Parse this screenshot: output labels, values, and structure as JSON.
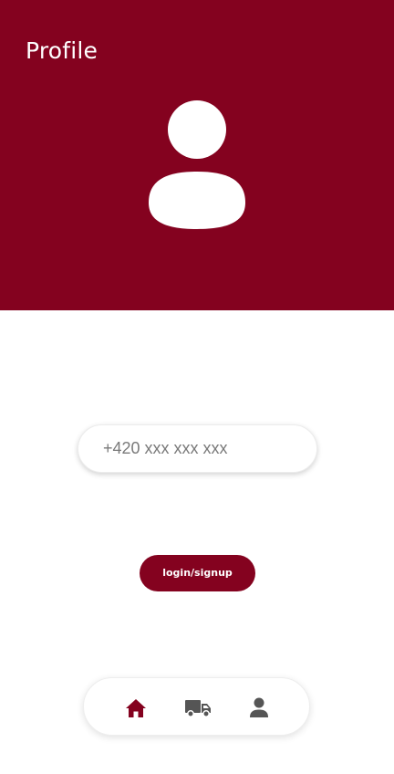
{
  "header": {
    "title": "Profile"
  },
  "avatar": {
    "icon": "user-avatar-icon"
  },
  "phone": {
    "placeholder": "+420 xxx xxx xxx",
    "value": ""
  },
  "actions": {
    "login_label": "login/signup"
  },
  "bottom_nav": {
    "items": [
      {
        "icon": "home-icon",
        "active": true
      },
      {
        "icon": "delivery-truck-icon",
        "active": false
      },
      {
        "icon": "user-icon",
        "active": false
      }
    ]
  },
  "colors": {
    "brand": "#84021f",
    "background": "#ffffff",
    "inactive_icon": "#555555"
  }
}
